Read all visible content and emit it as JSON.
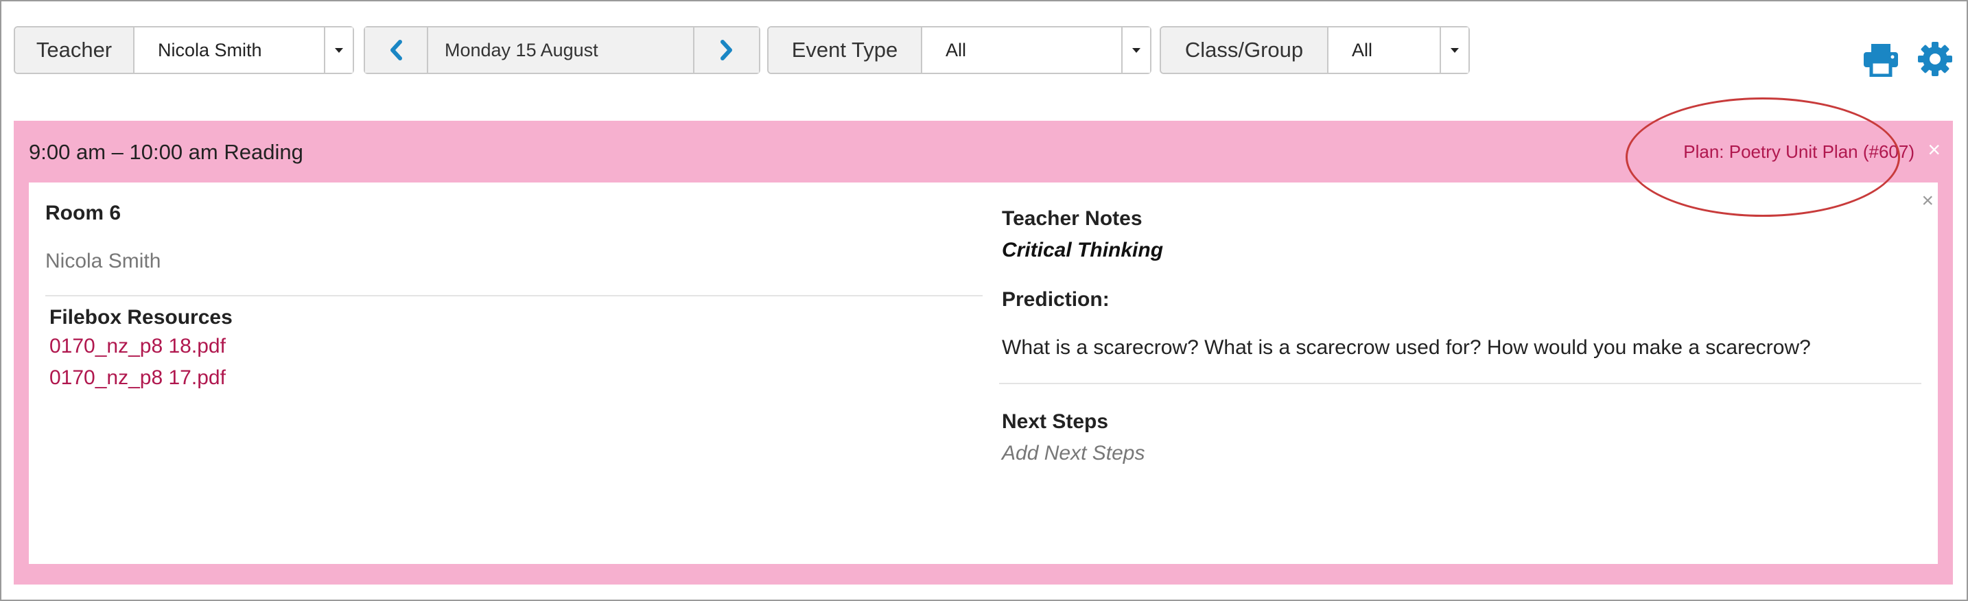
{
  "toolbar": {
    "teacher": {
      "label": "Teacher",
      "value": "Nicola Smith"
    },
    "date": {
      "value": "Monday 15 August"
    },
    "event_type": {
      "label": "Event Type",
      "value": "All"
    },
    "class_group": {
      "label": "Class/Group",
      "value": "All"
    }
  },
  "icons": {
    "prev": "chevron-left-icon",
    "next": "chevron-right-icon",
    "dropdown": "caret-down-icon",
    "print": "printer-icon",
    "settings": "gear-icon",
    "close": "close-icon"
  },
  "colors": {
    "accent_blue": "#1a86c4",
    "event_pink": "#f6b0cf",
    "link_crimson": "#b0174e",
    "highlight_red": "#c83b3b"
  },
  "event": {
    "time_title": "9:00 am – 10:00 am Reading",
    "plan_link": "Plan: Poetry Unit Plan (#607)",
    "close_glyph": "×",
    "room": "Room 6",
    "teacher": "Nicola Smith",
    "filebox_title": "Filebox Resources",
    "files": [
      "0170_nz_p8 18.pdf",
      "0170_nz_p8 17.pdf"
    ],
    "teacher_notes_title": "Teacher Notes",
    "teacher_notes_text": "Critical Thinking",
    "prediction_title": "Prediction:",
    "prediction_text": "What is a scarecrow? What is a scarecrow used for? How would you make a scarecrow?",
    "next_steps_title": "Next Steps",
    "next_steps_placeholder": "Add Next Steps"
  }
}
